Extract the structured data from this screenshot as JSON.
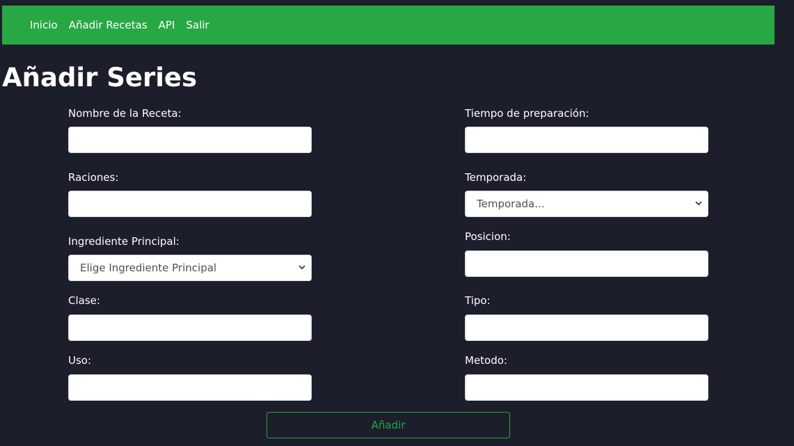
{
  "nav": {
    "items": [
      {
        "label": "Inicio"
      },
      {
        "label": "Añadir Recetas"
      },
      {
        "label": "API"
      },
      {
        "label": "Salir"
      }
    ],
    "background": "#28a745"
  },
  "page": {
    "title": "Añadir Series",
    "background": "#1c1e2b"
  },
  "form": {
    "nombre": {
      "label": "Nombre de la Receta:",
      "value": ""
    },
    "tiempo": {
      "label": "Tiempo de preparación:",
      "value": ""
    },
    "raciones": {
      "label": "Raciones:",
      "value": ""
    },
    "temporada": {
      "label": "Temporada:",
      "selected": "Temporada..."
    },
    "ingrediente": {
      "label": "Ingrediente Principal:",
      "selected": "Elige Ingrediente Principal"
    },
    "posicion": {
      "label": "Posicion:",
      "value": ""
    },
    "clase": {
      "label": "Clase:",
      "value": ""
    },
    "tipo": {
      "label": "Tipo:",
      "value": ""
    },
    "uso": {
      "label": "Uso:",
      "value": ""
    },
    "metodo": {
      "label": "Metodo:",
      "value": ""
    },
    "submit_label": "Añadir",
    "submit_color": "#28a745"
  }
}
